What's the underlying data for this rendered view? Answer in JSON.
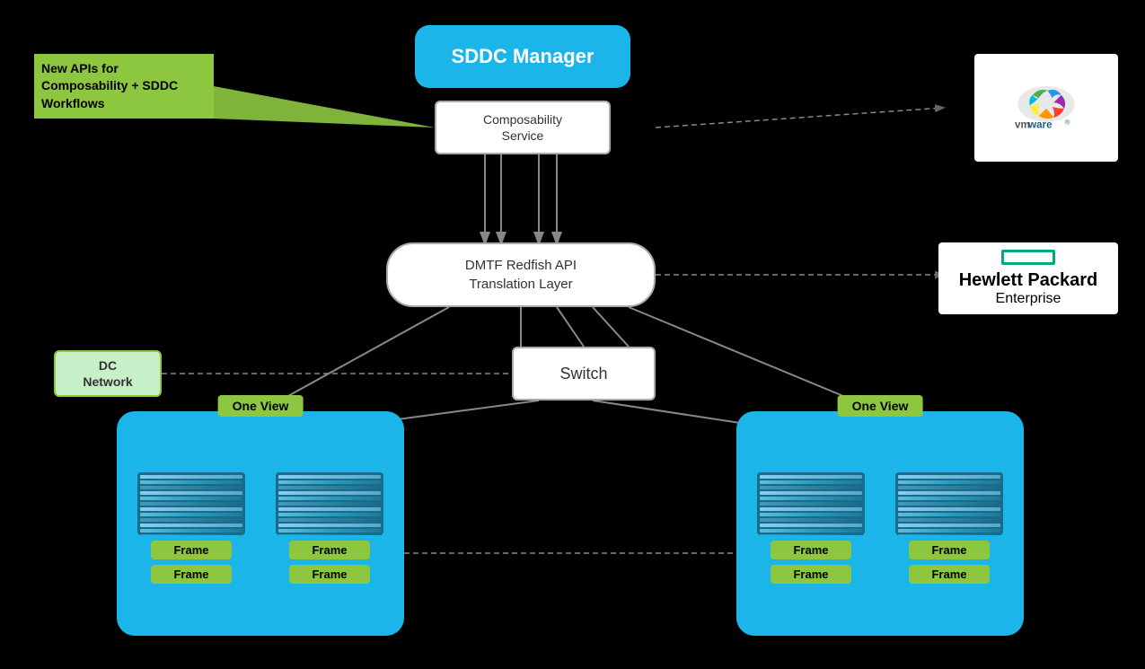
{
  "diagram": {
    "background": "#000000",
    "sddc_manager": {
      "label": "SDDC Manager"
    },
    "composability_service": {
      "label": "Composability\nService"
    },
    "new_apis": {
      "label": "New APIs for\nComposability +\nSDDC Workflows"
    },
    "dmtf": {
      "label": "DMTF Redfish API\nTranslation Layer"
    },
    "switch": {
      "label": "Switch"
    },
    "dc_network": {
      "label": "DC\nNetwork"
    },
    "one_view_left": {
      "badge": "One View"
    },
    "one_view_right": {
      "badge": "One View"
    },
    "frames": [
      "Frame",
      "Frame",
      "Frame",
      "Frame"
    ],
    "vmware_label": "vmware®",
    "hpe_label": "Hewlett Packard",
    "hpe_sub": "Enterprise"
  }
}
